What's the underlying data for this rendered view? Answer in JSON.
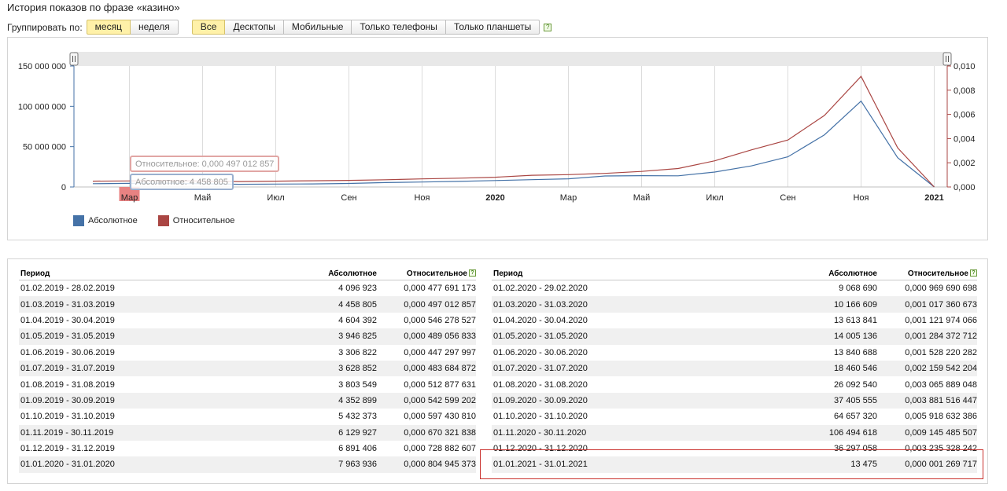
{
  "page_title": "История показов по фразе «казино»",
  "group_by": {
    "label": "Группировать по:",
    "options": [
      "месяц",
      "неделя"
    ],
    "selected": "месяц"
  },
  "device_filter": {
    "options": [
      "Все",
      "Десктопы",
      "Мобильные",
      "Только телефоны",
      "Только планшеты"
    ],
    "selected": "Все",
    "help": "?"
  },
  "chart_data": {
    "type": "line",
    "x": [
      "2019-02",
      "2019-03",
      "2019-04",
      "2019-05",
      "2019-06",
      "2019-07",
      "2019-08",
      "2019-09",
      "2019-10",
      "2019-11",
      "2019-12",
      "2020-01",
      "2020-02",
      "2020-03",
      "2020-04",
      "2020-05",
      "2020-06",
      "2020-07",
      "2020-08",
      "2020-09",
      "2020-10",
      "2020-11",
      "2020-12",
      "2021-01"
    ],
    "x_tick_labels": [
      "Мар",
      "Май",
      "Июл",
      "Сен",
      "Ноя",
      "2020",
      "Мар",
      "Май",
      "Июл",
      "Сен",
      "Ноя",
      "2021"
    ],
    "y_left_ticks": [
      "0",
      "50 000 000",
      "100 000 000",
      "150 000 000"
    ],
    "y_right_ticks": [
      "0,000",
      "0,002",
      "0,004",
      "0,006",
      "0,008",
      "0,010"
    ],
    "ylim_left": [
      0,
      150000000
    ],
    "ylim_right": [
      0,
      0.01
    ],
    "series": [
      {
        "name": "Абсолютное",
        "color": "#4572a7",
        "axis": "left",
        "values": [
          4096923,
          4458805,
          4604392,
          3946825,
          3306822,
          3628852,
          3803549,
          4352899,
          5432373,
          6129927,
          6891406,
          7963936,
          9068690,
          10166609,
          13613841,
          14005136,
          13840688,
          18460546,
          26092540,
          37405555,
          64657320,
          106494618,
          36297058,
          13475
        ]
      },
      {
        "name": "Относительное",
        "color": "#aa4643",
        "axis": "right",
        "values": [
          0.000477691173,
          0.000497012857,
          0.000546278527,
          0.000489056833,
          0.000447297997,
          0.000483684872,
          0.000512877631,
          0.000542599202,
          0.00059743081,
          0.000670321838,
          0.000728882607,
          0.000804945373,
          0.000969690698,
          0.001017360673,
          0.001121974066,
          0.001284372712,
          0.001528220282,
          0.002159542204,
          0.003065889048,
          0.003881516447,
          0.005918632386,
          0.009145485507,
          0.003235328242,
          1.269717e-06
        ]
      }
    ],
    "tooltip": {
      "relative": "Относительное: 0,000 497 012 857",
      "absolute": "Абсолютное: 4 458 805",
      "highlight_index": 1
    },
    "grid": true,
    "legend": "bottom-left"
  },
  "table": {
    "headers": {
      "period": "Период",
      "absolute": "Абсолютное",
      "relative": "Относительное"
    },
    "left": [
      [
        "01.02.2019 - 28.02.2019",
        "4 096 923",
        "0,000 477 691 173"
      ],
      [
        "01.03.2019 - 31.03.2019",
        "4 458 805",
        "0,000 497 012 857"
      ],
      [
        "01.04.2019 - 30.04.2019",
        "4 604 392",
        "0,000 546 278 527"
      ],
      [
        "01.05.2019 - 31.05.2019",
        "3 946 825",
        "0,000 489 056 833"
      ],
      [
        "01.06.2019 - 30.06.2019",
        "3 306 822",
        "0,000 447 297 997"
      ],
      [
        "01.07.2019 - 31.07.2019",
        "3 628 852",
        "0,000 483 684 872"
      ],
      [
        "01.08.2019 - 31.08.2019",
        "3 803 549",
        "0,000 512 877 631"
      ],
      [
        "01.09.2019 - 30.09.2019",
        "4 352 899",
        "0,000 542 599 202"
      ],
      [
        "01.10.2019 - 31.10.2019",
        "5 432 373",
        "0,000 597 430 810"
      ],
      [
        "01.11.2019 - 30.11.2019",
        "6 129 927",
        "0,000 670 321 838"
      ],
      [
        "01.12.2019 - 31.12.2019",
        "6 891 406",
        "0,000 728 882 607"
      ],
      [
        "01.01.2020 - 31.01.2020",
        "7 963 936",
        "0,000 804 945 373"
      ]
    ],
    "right": [
      [
        "01.02.2020 - 29.02.2020",
        "9 068 690",
        "0,000 969 690 698"
      ],
      [
        "01.03.2020 - 31.03.2020",
        "10 166 609",
        "0,001 017 360 673"
      ],
      [
        "01.04.2020 - 30.04.2020",
        "13 613 841",
        "0,001 121 974 066"
      ],
      [
        "01.05.2020 - 31.05.2020",
        "14 005 136",
        "0,001 284 372 712"
      ],
      [
        "01.06.2020 - 30.06.2020",
        "13 840 688",
        "0,001 528 220 282"
      ],
      [
        "01.07.2020 - 31.07.2020",
        "18 460 546",
        "0,002 159 542 204"
      ],
      [
        "01.08.2020 - 31.08.2020",
        "26 092 540",
        "0,003 065 889 048"
      ],
      [
        "01.09.2020 - 30.09.2020",
        "37 405 555",
        "0,003 881 516 447"
      ],
      [
        "01.10.2020 - 31.10.2020",
        "64 657 320",
        "0,005 918 632 386"
      ],
      [
        "01.11.2020 - 30.11.2020",
        "106 494 618",
        "0,009 145 485 507"
      ],
      [
        "01.12.2020 - 31.12.2020",
        "36 297 058",
        "0,003 235 328 242"
      ],
      [
        "01.01.2021 - 31.01.2021",
        "13 475",
        "0,000 001 269 717"
      ]
    ]
  }
}
